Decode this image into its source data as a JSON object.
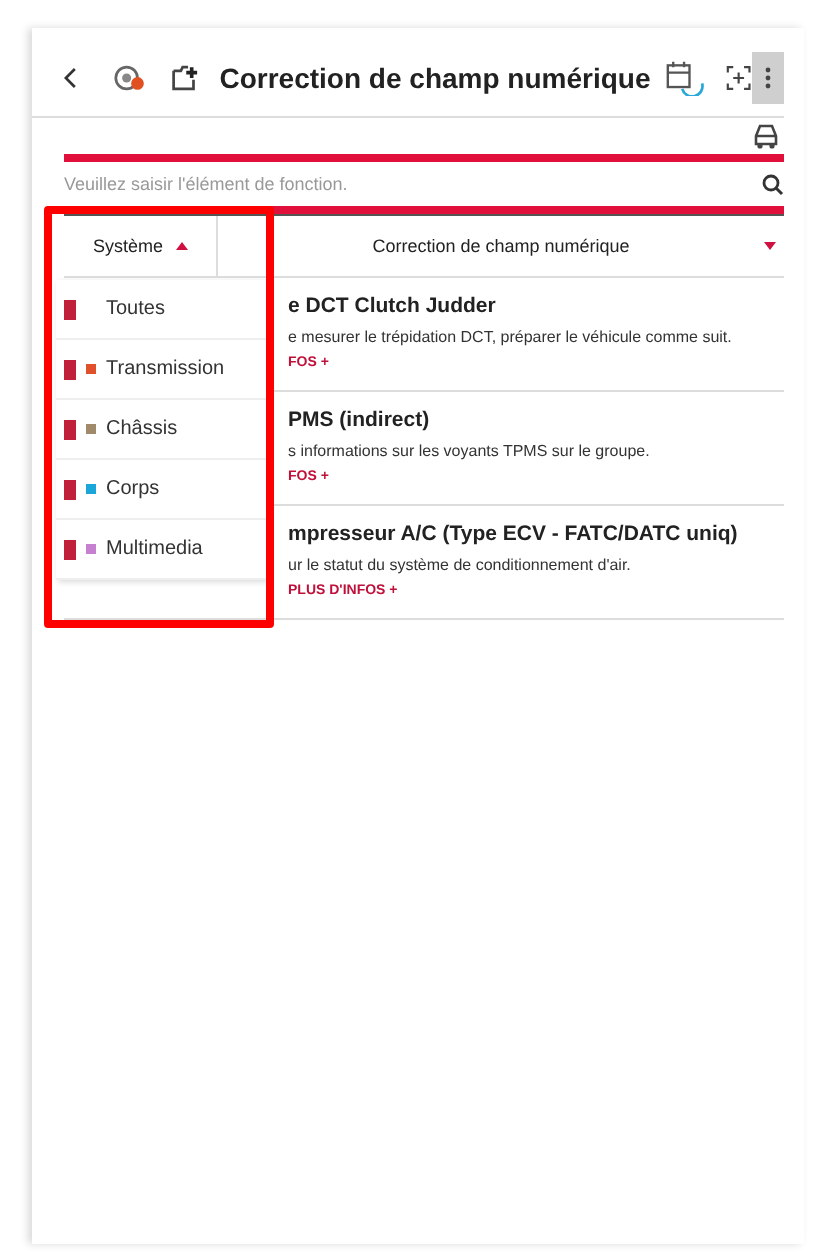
{
  "header": {
    "title": "Correction de champ numérique"
  },
  "search": {
    "placeholder": "Veuillez saisir l'élément de fonction."
  },
  "table": {
    "columns": [
      {
        "label": "Système",
        "sort_descending": false
      },
      {
        "label": "Correction de champ numérique",
        "sort_descending": true
      }
    ],
    "rows": [
      {
        "title": "e DCT Clutch Judder",
        "description": "e mesurer le trépidation DCT, préparer le véhicule comme suit.",
        "link": "FOS +"
      },
      {
        "title": "PMS (indirect)",
        "description": "s informations sur les voyants TPMS sur le groupe.",
        "link": "FOS +"
      },
      {
        "title": "mpresseur A/C (Type ECV - FATC/DATC uniq)",
        "description": "ur le statut du système de conditionnement d'air.",
        "link": "PLUS D'INFOS +"
      }
    ]
  },
  "system_filter": {
    "items": [
      {
        "label": "Toutes",
        "checked": true
      },
      {
        "label": "Transmission",
        "checked": true,
        "color": "#e0502a"
      },
      {
        "label": "Châssis",
        "checked": true,
        "color": "#a08a6a"
      },
      {
        "label": "Corps",
        "checked": true,
        "color": "#1aa6d8"
      },
      {
        "label": "Multimedia",
        "checked": true,
        "color": "#c77fd0"
      }
    ]
  }
}
